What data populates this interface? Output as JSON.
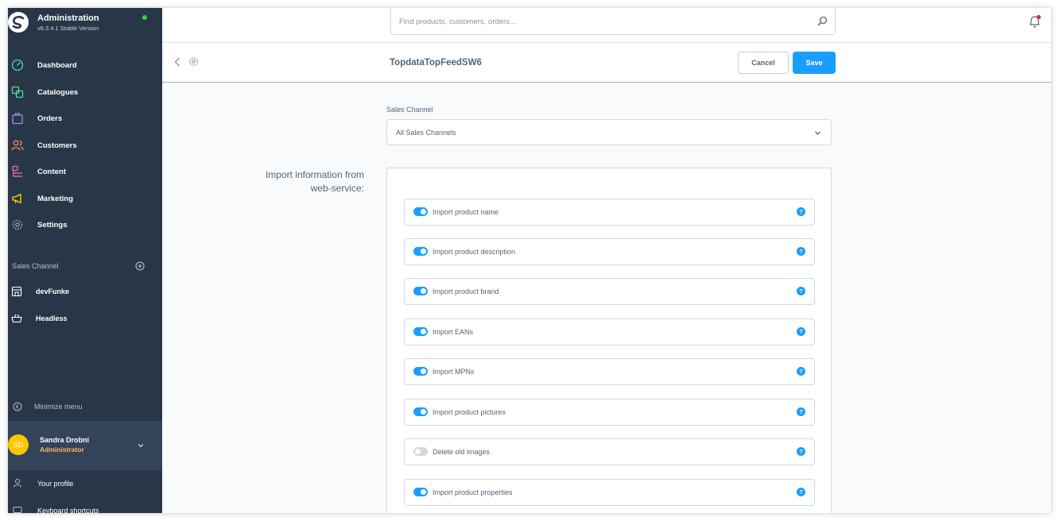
{
  "brand": {
    "title": "Administration",
    "version": "v6.3.4.1 Stable Version"
  },
  "nav": [
    {
      "label": "Dashboard",
      "icon": "gauge-icon",
      "color": "#57d9a3"
    },
    {
      "label": "Catalogues",
      "icon": "catalogue-icon",
      "color": "#57d9a3"
    },
    {
      "label": "Orders",
      "icon": "shopping-bag-icon",
      "color": "#a092f0"
    },
    {
      "label": "Customers",
      "icon": "users-icon",
      "color": "#f88962"
    },
    {
      "label": "Content",
      "icon": "content-icon",
      "color": "#ff68b4"
    },
    {
      "label": "Marketing",
      "icon": "megaphone-icon",
      "color": "#ffd700"
    },
    {
      "label": "Settings",
      "icon": "gear-icon",
      "color": "#9aa8b5"
    }
  ],
  "sales_channel": {
    "heading": "Sales Channel",
    "items": [
      {
        "label": "devFunke",
        "icon": "storefront-icon"
      },
      {
        "label": "Headless",
        "icon": "basket-icon"
      }
    ]
  },
  "minimize_label": "Minimize menu",
  "user": {
    "initials": "SD",
    "name": "Sandra Drobni",
    "role": "Administrator"
  },
  "bottom_links": [
    {
      "label": "Your profile",
      "icon": "user-icon"
    },
    {
      "label": "Keyboard shortcuts",
      "icon": "keyboard-icon"
    }
  ],
  "search": {
    "placeholder": "Find products, customers, orders..."
  },
  "header": {
    "title": "TopdataTopFeedSW6",
    "cancel_label": "Cancel",
    "save_label": "Save"
  },
  "form": {
    "sales_channel_label": "Sales Channel",
    "sales_channel_value": "All Sales Channels",
    "import_heading_line1": "Import information from",
    "import_heading_line2": "web-service:",
    "options": [
      {
        "label": "Import product name",
        "enabled": true
      },
      {
        "label": "Import product description",
        "enabled": true
      },
      {
        "label": "Import product brand",
        "enabled": true
      },
      {
        "label": "Import EANs",
        "enabled": true
      },
      {
        "label": "Import MPNs",
        "enabled": true
      },
      {
        "label": "Import product pictures",
        "enabled": true
      },
      {
        "label": "Delete old images",
        "enabled": false
      },
      {
        "label": "Import product properties",
        "enabled": true
      }
    ],
    "help_glyph": "?"
  },
  "colors": {
    "sidebar": "#283747",
    "accent": "#189eff",
    "text": "#52667a",
    "status_online": "#37d046",
    "role": "#ffb75d"
  }
}
